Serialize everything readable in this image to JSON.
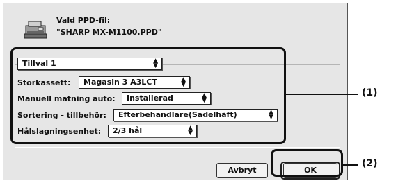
{
  "header": {
    "title": "Vald PPD-fil:",
    "filename": "\"SHARP MX-M1100.PPD\""
  },
  "options_group": {
    "selector": "Tillval 1",
    "storkassett_label": "Storkassett:",
    "storkassett_value": "Magasin 3 A3LCT",
    "manuell_label": "Manuell matning auto:",
    "manuell_value": "Installerad",
    "sortering_label": "Sortering - tillbehör:",
    "sortering_value": "Efterbehandlare(Sadelhäft)",
    "halslag_label": "Hålslagningsenhet:",
    "halslag_value": "2/3 hål"
  },
  "buttons": {
    "cancel": "Avbryt",
    "ok": "OK"
  },
  "callouts": {
    "one": "(1)",
    "two": "(2)"
  },
  "icons": {
    "printer": "printer-icon",
    "popup_arrows": "up-down-arrows-icon"
  }
}
